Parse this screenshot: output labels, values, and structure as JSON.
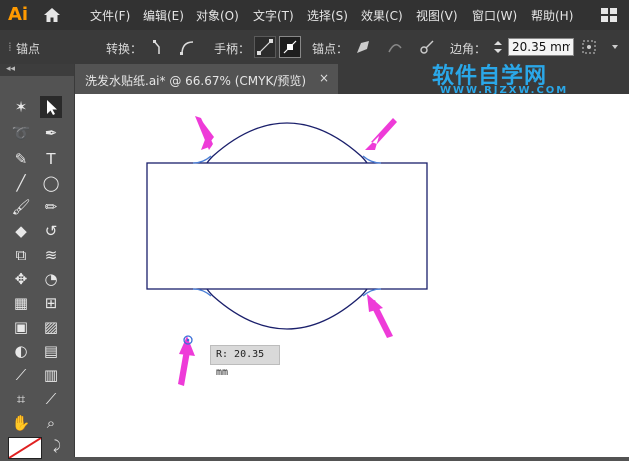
{
  "app": {
    "logo": "Ai"
  },
  "menu": [
    "文件(F)",
    "编辑(E)",
    "对象(O)",
    "文字(T)",
    "选择(S)",
    "效果(C)",
    "视图(V)",
    "窗口(W)",
    "帮助(H)"
  ],
  "control_bar": {
    "anchor_label": "锚点",
    "convert_label": "转换：",
    "handles_label": "手柄：",
    "anchor_point_label": "锚点：",
    "corner_label": "边角：",
    "corner_value": "20.35 mm"
  },
  "document_tab": {
    "title": "洗发水贴纸.ai* @ 66.67% (CMYK/预览)",
    "close": "×"
  },
  "toolpanel": {
    "collapse": "◂◂"
  },
  "watermark": {
    "line1": "软件自学网",
    "line2": "WWW.RJZXW.COM"
  },
  "tooltip": {
    "text": "R: 20.35 mm"
  },
  "colors": {
    "menubar": "#323232",
    "canvas": "#ffffff",
    "path": "#1a1f6b",
    "highlight": "#4a7fd6",
    "arrow": "#ee3bd8",
    "watermark": "#2aa7e8"
  },
  "icons": [
    "home-icon",
    "selection-tool-icon",
    "direct-selection-icon",
    "magic-wand-icon",
    "pen-icon",
    "type-icon",
    "line-icon",
    "ellipse-icon",
    "brush-icon",
    "pencil-icon",
    "eraser-icon",
    "rotate-icon",
    "scale-icon",
    "warp-icon",
    "pin-icon",
    "shape-builder-icon",
    "perspective-icon",
    "mesh-icon",
    "gradient-icon",
    "eyedropper-icon",
    "chart-icon",
    "artboard-icon",
    "slice-icon",
    "hand-icon",
    "zoom-icon"
  ]
}
